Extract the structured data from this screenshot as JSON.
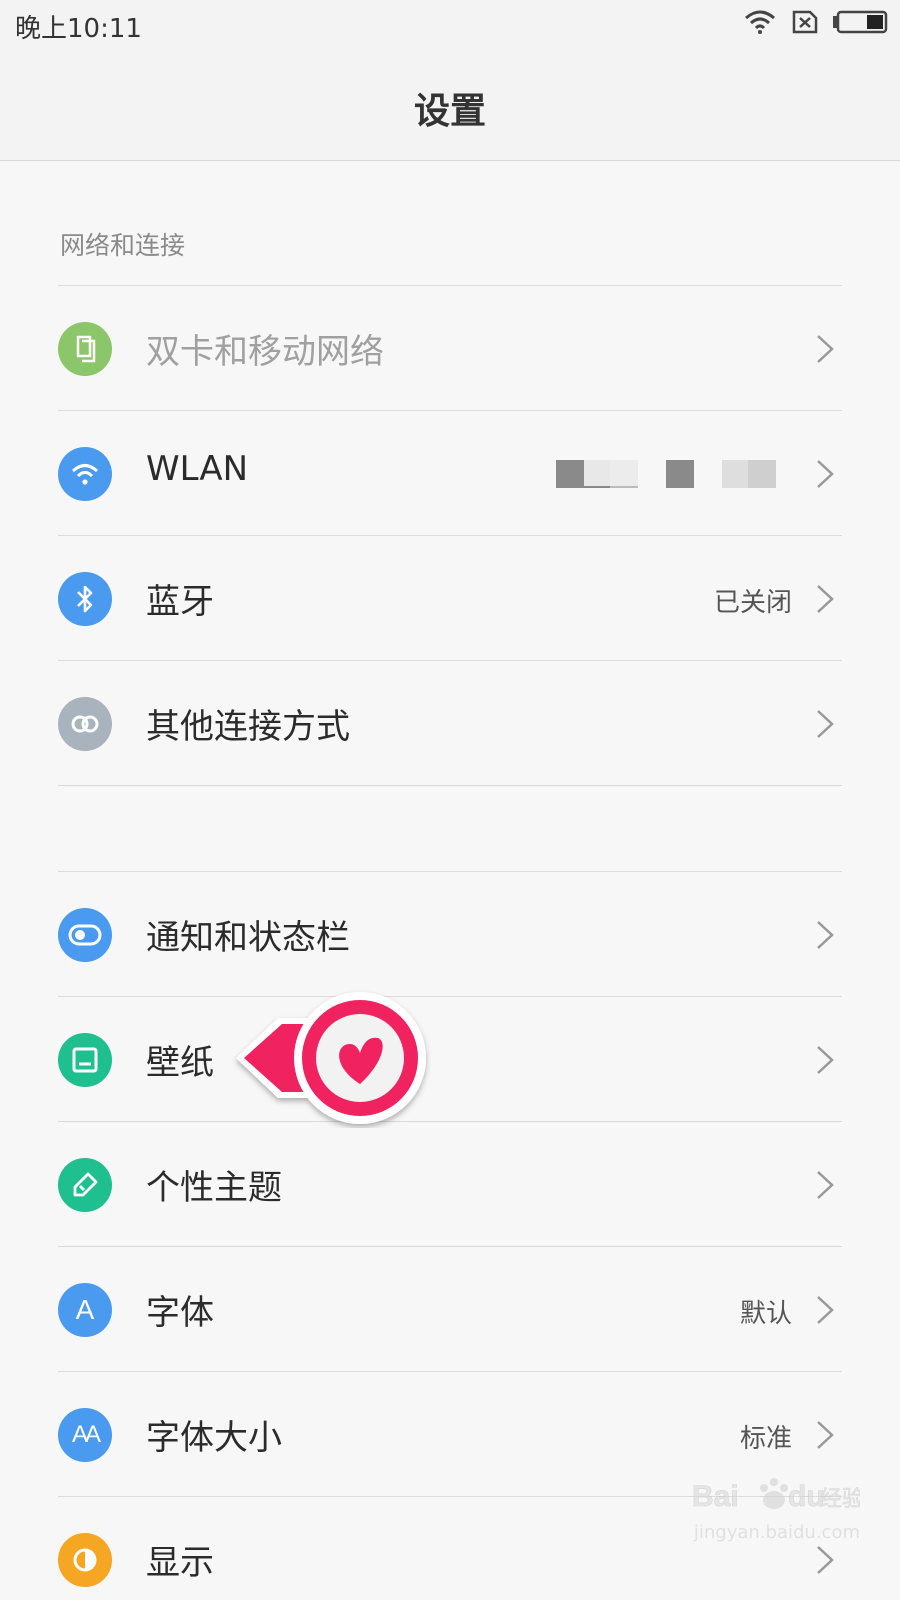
{
  "status_bar": {
    "time": "晚上10:11",
    "icons": [
      "wifi-icon",
      "no-sim-icon",
      "battery-icon"
    ]
  },
  "header": {
    "title": "设置"
  },
  "sections": [
    {
      "title": "网络和连接",
      "items": [
        {
          "label": "双卡和移动网络",
          "value": "",
          "icon": "dual-sim-icon",
          "color": "#8cc66a",
          "disabled": true
        },
        {
          "label": "WLAN",
          "value": "",
          "icon": "wifi-icon",
          "color": "#4a9bef",
          "redacted": true
        },
        {
          "label": "蓝牙",
          "value": "已关闭",
          "icon": "bluetooth-icon",
          "color": "#4a9bef"
        },
        {
          "label": "其他连接方式",
          "value": "",
          "icon": "link-icon",
          "color": "#a9b3bd"
        }
      ]
    },
    {
      "title": "",
      "items": [
        {
          "label": "通知和状态栏",
          "value": "",
          "icon": "toggle-icon",
          "color": "#4a9bef"
        },
        {
          "label": "壁纸",
          "value": "",
          "icon": "wallpaper-icon",
          "color": "#1fbf8f"
        },
        {
          "label": "个性主题",
          "value": "",
          "icon": "theme-brush-icon",
          "color": "#1fbf8f"
        },
        {
          "label": "字体",
          "value": "默认",
          "icon": "font-icon",
          "color": "#4a9bef"
        },
        {
          "label": "字体大小",
          "value": "标准",
          "icon": "font-size-icon",
          "color": "#4a9bef"
        },
        {
          "label": "显示",
          "value": "",
          "icon": "display-icon",
          "color": "#f5a623"
        }
      ]
    }
  ],
  "annotation": {
    "icon": "heart-pointer-icon",
    "color": "#f0245f"
  },
  "watermark": {
    "text": "Baidu经验",
    "url_text": "jingyan.baidu.com"
  }
}
